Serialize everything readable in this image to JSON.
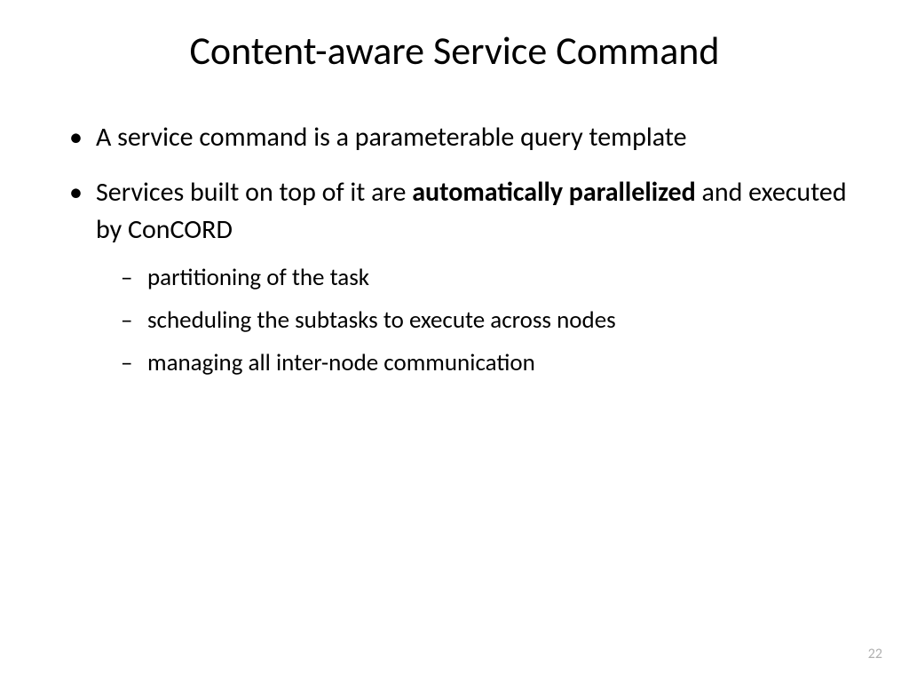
{
  "title": "Content-aware Service Command",
  "bullets": {
    "b1": "A service command is a parameterable query template",
    "b2_pre": "Services built on top of it are ",
    "b2_bold": "automatically parallelized",
    "b2_post": " and executed by ConCORD",
    "sub1": "partitioning of the task",
    "sub2": "scheduling the subtasks to execute across nodes",
    "sub3": "managing all inter-node communication"
  },
  "pageNumber": "22"
}
